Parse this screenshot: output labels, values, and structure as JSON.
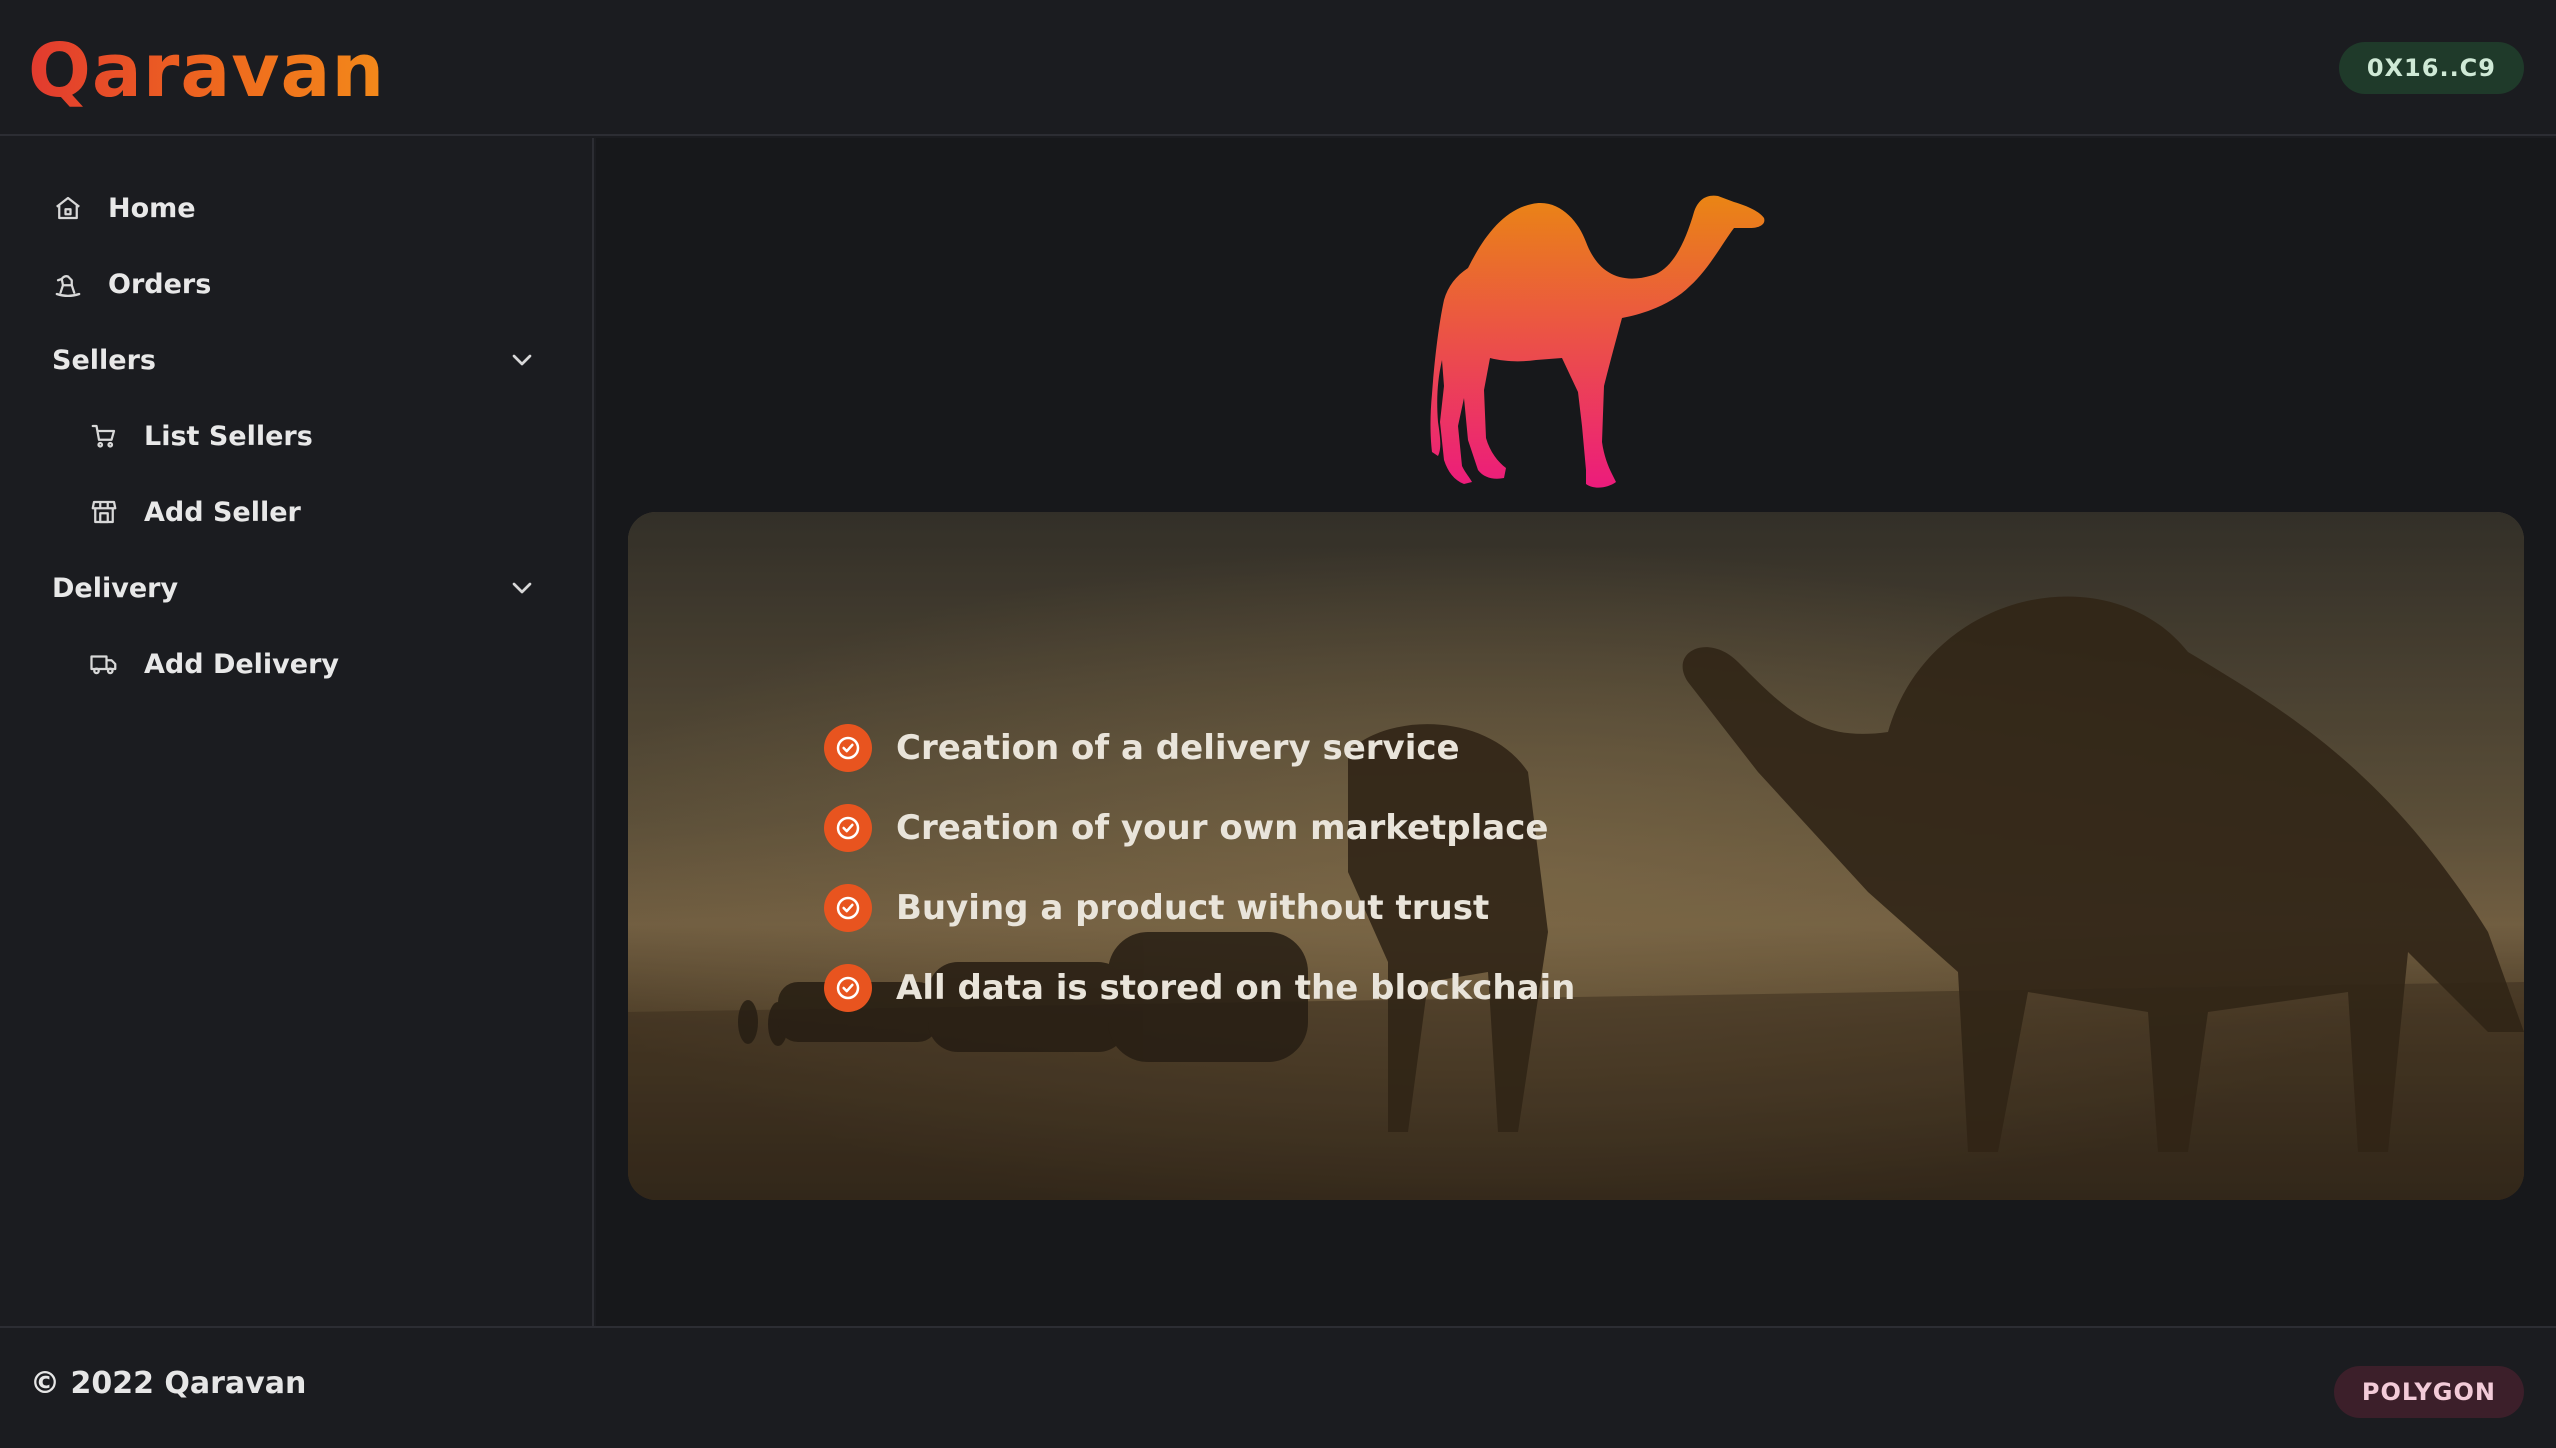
{
  "header": {
    "logo": "Qaravan",
    "wallet_address": "0X16..C9"
  },
  "sidebar": {
    "items": [
      {
        "label": "Home",
        "icon": "home-icon"
      },
      {
        "label": "Orders",
        "icon": "rocking-horse-icon"
      }
    ],
    "sections": [
      {
        "label": "Sellers",
        "expanded": true,
        "items": [
          {
            "label": "List Sellers",
            "icon": "cart-icon"
          },
          {
            "label": "Add Seller",
            "icon": "store-icon"
          }
        ]
      },
      {
        "label": "Delivery",
        "expanded": true,
        "items": [
          {
            "label": "Add Delivery",
            "icon": "truck-icon"
          }
        ]
      }
    ]
  },
  "main": {
    "logo_icon": "camel-icon",
    "features": [
      "Creation of a delivery service",
      "Creation of your own marketplace",
      "Buying a product without trust",
      "All data is stored on the blockchain"
    ]
  },
  "footer": {
    "copyright": "© 2022 Qaravan",
    "network": "POLYGON"
  },
  "colors": {
    "accent": "#e8541f",
    "logo_gradient_start": "#e23a2f",
    "logo_gradient_end": "#f3891a",
    "camel_gradient_top": "#ea8514",
    "camel_gradient_bottom": "#ec1b7c",
    "wallet_badge": "#1f3a2a",
    "network_badge": "#3c1f2a",
    "background": "#1b1c20"
  }
}
